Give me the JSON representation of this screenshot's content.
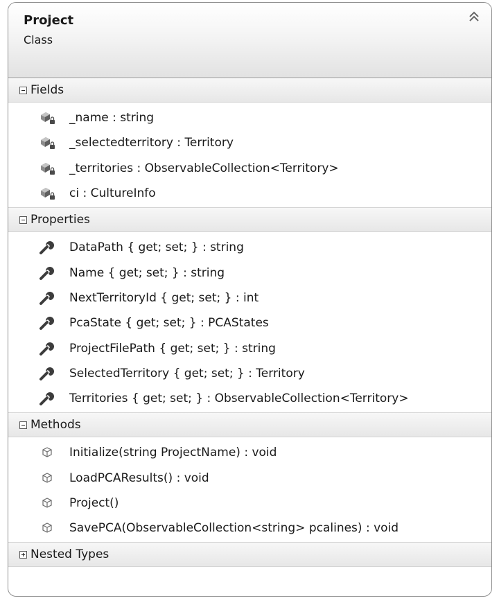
{
  "class": {
    "name": "Project",
    "stereotype": "Class",
    "collapse_icon": "double-chevron-up-icon"
  },
  "sections": {
    "fields": {
      "label": "Fields",
      "expanded": true,
      "items": [
        {
          "text": "_name : string",
          "icon": "private-field-icon"
        },
        {
          "text": "_selectedterritory : Territory",
          "icon": "private-field-icon"
        },
        {
          "text": "_territories  :  ObservableCollection<Territory>",
          "icon": "private-field-icon"
        },
        {
          "text": "ci : CultureInfo",
          "icon": "private-field-icon"
        }
      ]
    },
    "properties": {
      "label": "Properties",
      "expanded": true,
      "items": [
        {
          "text": "DataPath { get; set; } : string",
          "icon": "property-wrench-icon"
        },
        {
          "text": "Name { get; set; } : string",
          "icon": "property-wrench-icon"
        },
        {
          "text": "NextTerritoryId { get; set; } : int",
          "icon": "property-wrench-icon"
        },
        {
          "text": "PcaState { get; set; } : PCAStates",
          "icon": "property-wrench-icon"
        },
        {
          "text": "ProjectFilePath { get; set; } : string",
          "icon": "property-wrench-icon"
        },
        {
          "text": "SelectedTerritory { get; set; } : Territory",
          "icon": "property-wrench-icon"
        },
        {
          "text": "Territories  { get;  set; }  : ObservableCollection<Territory>",
          "icon": "property-wrench-icon"
        }
      ]
    },
    "methods": {
      "label": "Methods",
      "expanded": true,
      "items": [
        {
          "text": "Initialize(string ProjectName) : void",
          "icon": "method-cube-icon"
        },
        {
          "text": "LoadPCAResults() : void",
          "icon": "method-cube-icon"
        },
        {
          "text": "Project()",
          "icon": "method-cube-icon"
        },
        {
          "text": "SavePCA(ObservableCollection<string>  pcalines)  : void",
          "icon": "method-cube-icon"
        }
      ]
    },
    "nested_types": {
      "label": "Nested Types",
      "expanded": false,
      "items": []
    }
  }
}
